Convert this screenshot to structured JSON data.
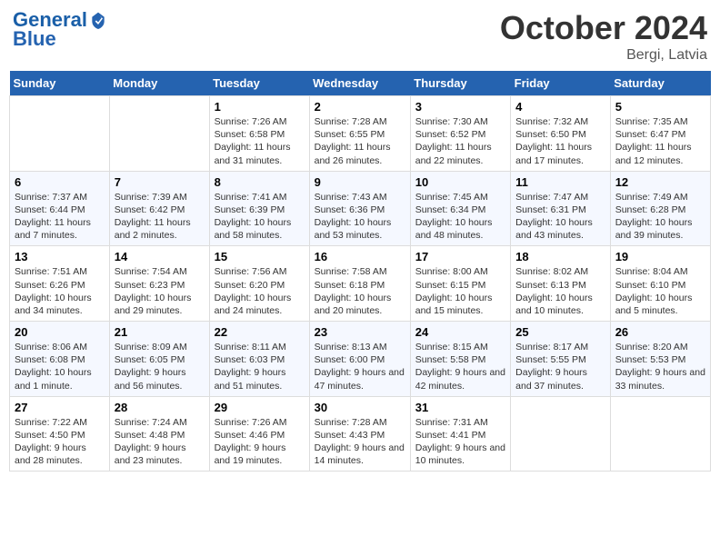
{
  "header": {
    "logo_line1": "General",
    "logo_line2": "Blue",
    "month": "October 2024",
    "location": "Bergi, Latvia"
  },
  "weekdays": [
    "Sunday",
    "Monday",
    "Tuesday",
    "Wednesday",
    "Thursday",
    "Friday",
    "Saturday"
  ],
  "weeks": [
    [
      null,
      null,
      {
        "day": 1,
        "sunrise": "7:26 AM",
        "sunset": "6:58 PM",
        "daylight": "11 hours and 31 minutes."
      },
      {
        "day": 2,
        "sunrise": "7:28 AM",
        "sunset": "6:55 PM",
        "daylight": "11 hours and 26 minutes."
      },
      {
        "day": 3,
        "sunrise": "7:30 AM",
        "sunset": "6:52 PM",
        "daylight": "11 hours and 22 minutes."
      },
      {
        "day": 4,
        "sunrise": "7:32 AM",
        "sunset": "6:50 PM",
        "daylight": "11 hours and 17 minutes."
      },
      {
        "day": 5,
        "sunrise": "7:35 AM",
        "sunset": "6:47 PM",
        "daylight": "11 hours and 12 minutes."
      }
    ],
    [
      {
        "day": 6,
        "sunrise": "7:37 AM",
        "sunset": "6:44 PM",
        "daylight": "11 hours and 7 minutes."
      },
      {
        "day": 7,
        "sunrise": "7:39 AM",
        "sunset": "6:42 PM",
        "daylight": "11 hours and 2 minutes."
      },
      {
        "day": 8,
        "sunrise": "7:41 AM",
        "sunset": "6:39 PM",
        "daylight": "10 hours and 58 minutes."
      },
      {
        "day": 9,
        "sunrise": "7:43 AM",
        "sunset": "6:36 PM",
        "daylight": "10 hours and 53 minutes."
      },
      {
        "day": 10,
        "sunrise": "7:45 AM",
        "sunset": "6:34 PM",
        "daylight": "10 hours and 48 minutes."
      },
      {
        "day": 11,
        "sunrise": "7:47 AM",
        "sunset": "6:31 PM",
        "daylight": "10 hours and 43 minutes."
      },
      {
        "day": 12,
        "sunrise": "7:49 AM",
        "sunset": "6:28 PM",
        "daylight": "10 hours and 39 minutes."
      }
    ],
    [
      {
        "day": 13,
        "sunrise": "7:51 AM",
        "sunset": "6:26 PM",
        "daylight": "10 hours and 34 minutes."
      },
      {
        "day": 14,
        "sunrise": "7:54 AM",
        "sunset": "6:23 PM",
        "daylight": "10 hours and 29 minutes."
      },
      {
        "day": 15,
        "sunrise": "7:56 AM",
        "sunset": "6:20 PM",
        "daylight": "10 hours and 24 minutes."
      },
      {
        "day": 16,
        "sunrise": "7:58 AM",
        "sunset": "6:18 PM",
        "daylight": "10 hours and 20 minutes."
      },
      {
        "day": 17,
        "sunrise": "8:00 AM",
        "sunset": "6:15 PM",
        "daylight": "10 hours and 15 minutes."
      },
      {
        "day": 18,
        "sunrise": "8:02 AM",
        "sunset": "6:13 PM",
        "daylight": "10 hours and 10 minutes."
      },
      {
        "day": 19,
        "sunrise": "8:04 AM",
        "sunset": "6:10 PM",
        "daylight": "10 hours and 5 minutes."
      }
    ],
    [
      {
        "day": 20,
        "sunrise": "8:06 AM",
        "sunset": "6:08 PM",
        "daylight": "10 hours and 1 minute."
      },
      {
        "day": 21,
        "sunrise": "8:09 AM",
        "sunset": "6:05 PM",
        "daylight": "9 hours and 56 minutes."
      },
      {
        "day": 22,
        "sunrise": "8:11 AM",
        "sunset": "6:03 PM",
        "daylight": "9 hours and 51 minutes."
      },
      {
        "day": 23,
        "sunrise": "8:13 AM",
        "sunset": "6:00 PM",
        "daylight": "9 hours and 47 minutes."
      },
      {
        "day": 24,
        "sunrise": "8:15 AM",
        "sunset": "5:58 PM",
        "daylight": "9 hours and 42 minutes."
      },
      {
        "day": 25,
        "sunrise": "8:17 AM",
        "sunset": "5:55 PM",
        "daylight": "9 hours and 37 minutes."
      },
      {
        "day": 26,
        "sunrise": "8:20 AM",
        "sunset": "5:53 PM",
        "daylight": "9 hours and 33 minutes."
      }
    ],
    [
      {
        "day": 27,
        "sunrise": "7:22 AM",
        "sunset": "4:50 PM",
        "daylight": "9 hours and 28 minutes."
      },
      {
        "day": 28,
        "sunrise": "7:24 AM",
        "sunset": "4:48 PM",
        "daylight": "9 hours and 23 minutes."
      },
      {
        "day": 29,
        "sunrise": "7:26 AM",
        "sunset": "4:46 PM",
        "daylight": "9 hours and 19 minutes."
      },
      {
        "day": 30,
        "sunrise": "7:28 AM",
        "sunset": "4:43 PM",
        "daylight": "9 hours and 14 minutes."
      },
      {
        "day": 31,
        "sunrise": "7:31 AM",
        "sunset": "4:41 PM",
        "daylight": "9 hours and 10 minutes."
      },
      null,
      null
    ]
  ]
}
